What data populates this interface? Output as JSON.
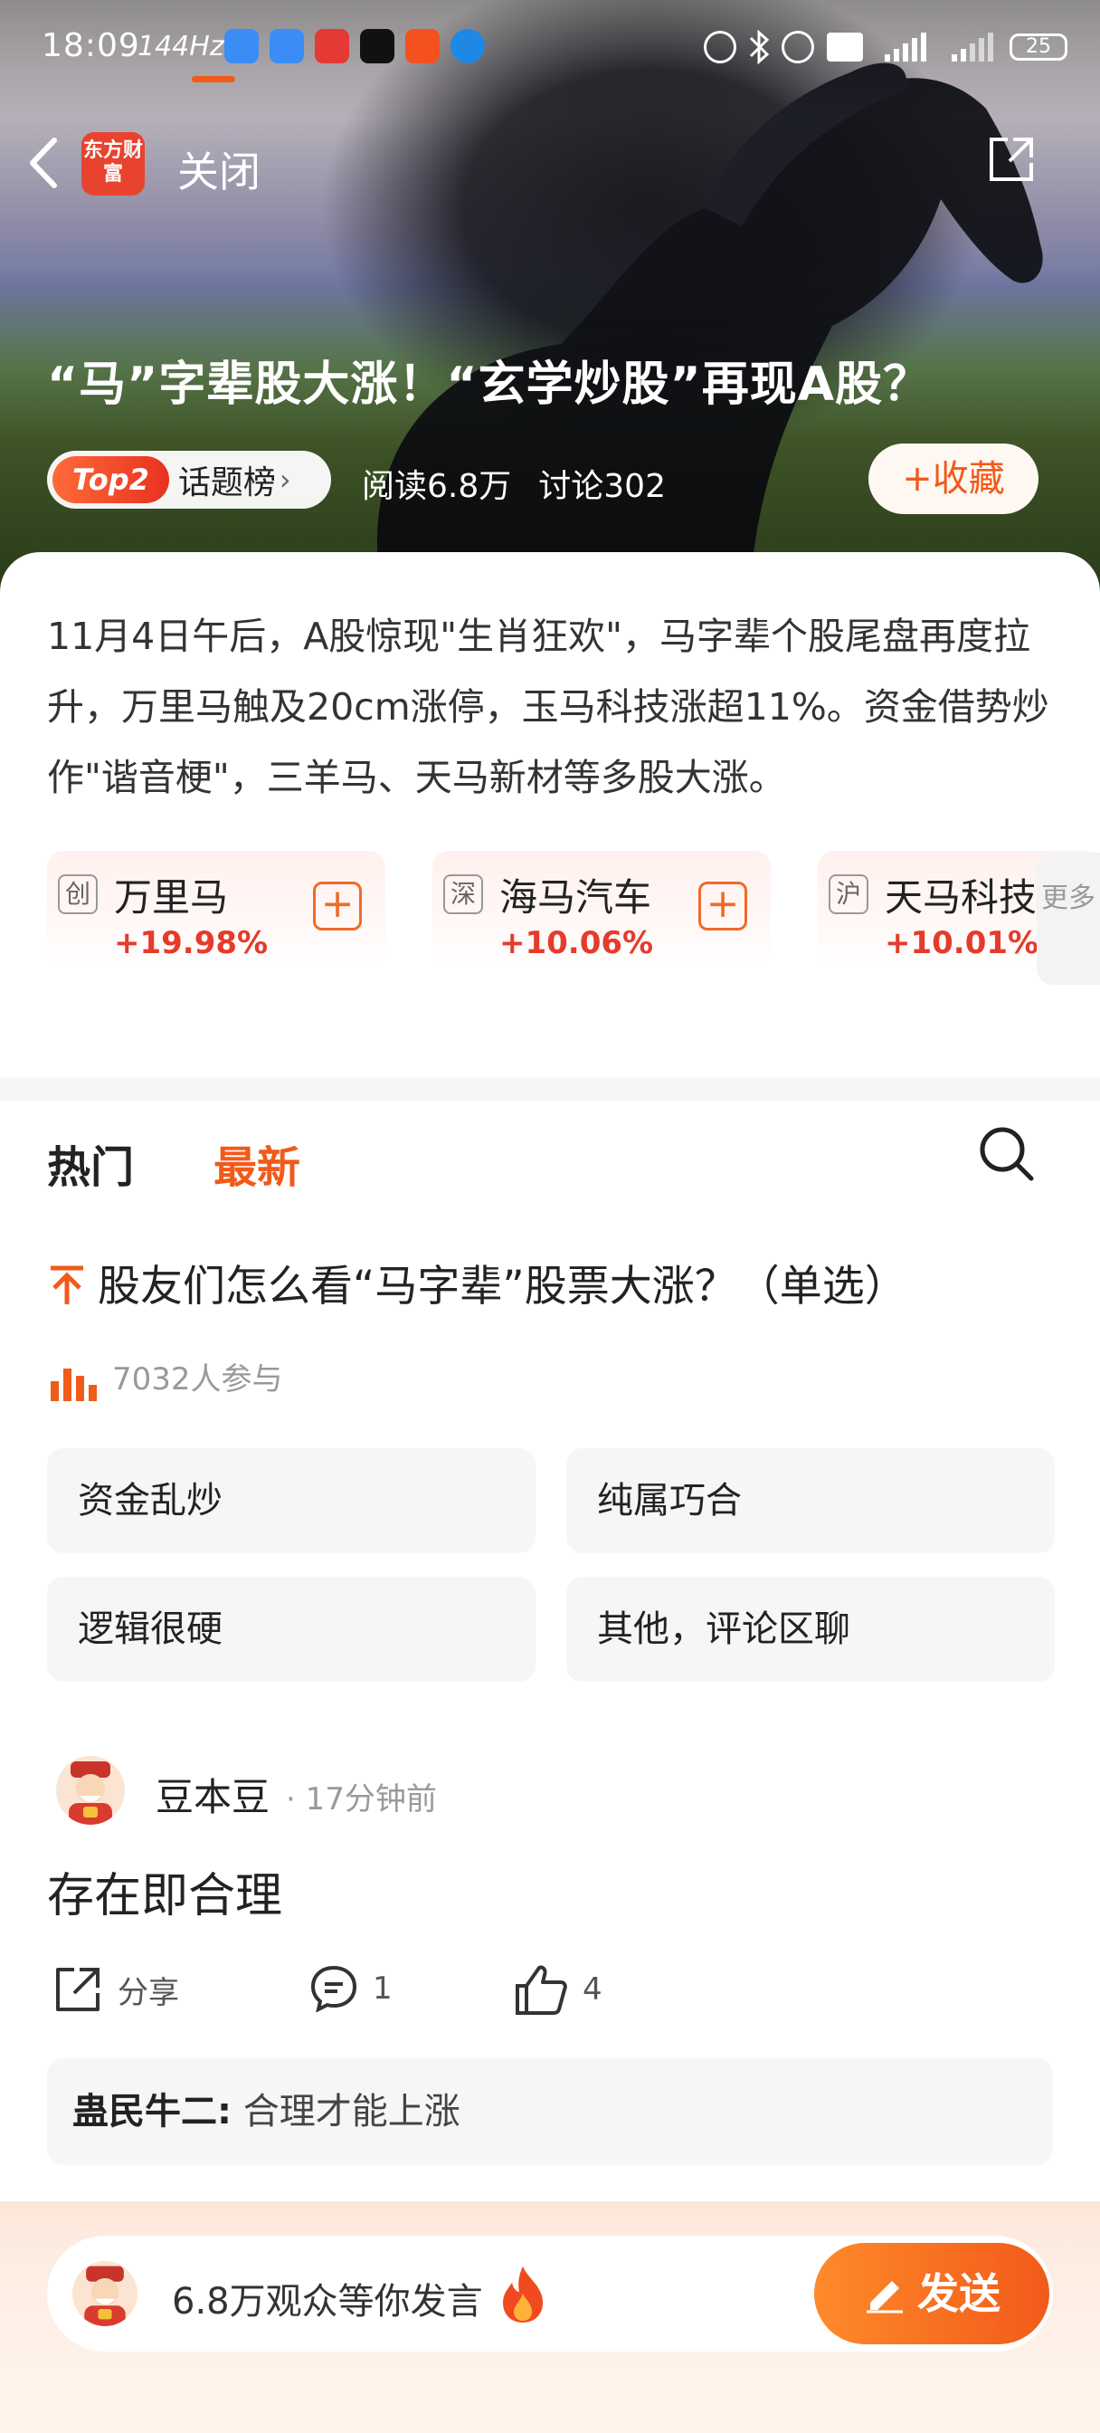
{
  "status_bar": {
    "time": "18:09",
    "refresh": "144Hz",
    "battery": "25"
  },
  "nav": {
    "logo_text": "东方财富",
    "close_label": "关闭"
  },
  "topic": {
    "title": "“马”字辈股大涨！“玄学炒股”再现A股？",
    "rank_badge": "Top2",
    "rank_label": "话题榜",
    "reads": "阅读6.8万",
    "discussions": "讨论302",
    "collect_label": "+收藏",
    "summary": "11月4日午后，A股惊现\"生肖狂欢\"，马字辈个股尾盘再度拉升，万里马触及20cm涨停，玉马科技涨超11%。资金借势炒作\"谐音梗\"，三羊马、天马新材等多股大涨。"
  },
  "stocks": [
    {
      "tag": "创",
      "name": "万里马",
      "change": "+19.98%"
    },
    {
      "tag": "深",
      "name": "海马汽车",
      "change": "+10.06%"
    },
    {
      "tag": "沪",
      "name": "天马科技",
      "change": "+10.01%"
    }
  ],
  "more_label": "更多",
  "tabs": {
    "hot": "热门",
    "latest": "最新"
  },
  "poll": {
    "question": "股友们怎么看“马字辈”股票大涨？（单选）",
    "participants": "7032人参与",
    "options": [
      "资金乱炒",
      "纯属巧合",
      "逻辑很硬",
      "其他，评论区聊"
    ]
  },
  "post": {
    "user": "豆本豆",
    "time": "· 17分钟前",
    "content": "存在即合理",
    "share_label": "分享",
    "comment_count": "1",
    "like_count": "4",
    "reply_user": "蛊民牛二:",
    "reply_text": "合理才能上涨"
  },
  "bottom_bar": {
    "prompt": "6.8万观众等你发言",
    "send_label": "发送"
  },
  "colors": {
    "accent": "#f25a1a",
    "rise": "#e63a2b",
    "logo": "#e8432f"
  }
}
